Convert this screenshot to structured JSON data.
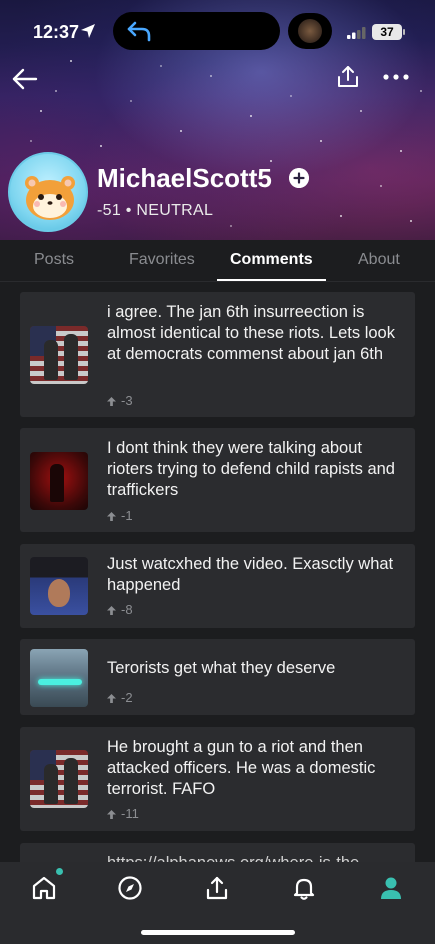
{
  "status_bar": {
    "time": "12:37",
    "battery": "37"
  },
  "profile": {
    "username": "MichaelScott5",
    "karma_line": "-51 • NEUTRAL"
  },
  "tabs": [
    {
      "label": "Posts",
      "active": false
    },
    {
      "label": "Favorites",
      "active": false
    },
    {
      "label": "Comments",
      "active": true
    },
    {
      "label": "About",
      "active": false
    }
  ],
  "comments": [
    {
      "text": "i agree. The jan 6th insurreection is almost identical to these riots. Lets look at democrats commenst about jan 6th",
      "score": "-3",
      "thumb": "flag-soldiers"
    },
    {
      "text": "I dont think they were talking about rioters trying to defend child rapists and traffickers",
      "score": "-1",
      "thumb": "red-image"
    },
    {
      "text": "Just watcxhed the video. Exasctly what happened",
      "score": "-8",
      "thumb": "tv-news"
    },
    {
      "text": "Terorists get what they deserve",
      "score": "-2",
      "thumb": "jet"
    },
    {
      "text": "He brought a gun to a riot and then attacked officers. He was a domestic terrorist. FAFO",
      "score": "-11",
      "thumb": "flag-soldiers"
    },
    {
      "text": "https://alphanews.org/where-is-the",
      "score": "",
      "thumb": "none"
    }
  ],
  "colors": {
    "background": "#1c1d1f",
    "card": "#2b2c2f",
    "accent": "#39c0b0",
    "muted_text": "#8a8c90"
  },
  "icons": {
    "back": "arrow-left-icon",
    "share": "share-icon",
    "more": "more-dots-icon",
    "follow": "plus-circle-icon",
    "upvote": "upvote-arrow-icon",
    "nav_home": "home-icon",
    "nav_explore": "compass-icon",
    "nav_post": "upload-icon",
    "nav_notifications": "bell-icon",
    "nav_profile": "person-icon"
  }
}
